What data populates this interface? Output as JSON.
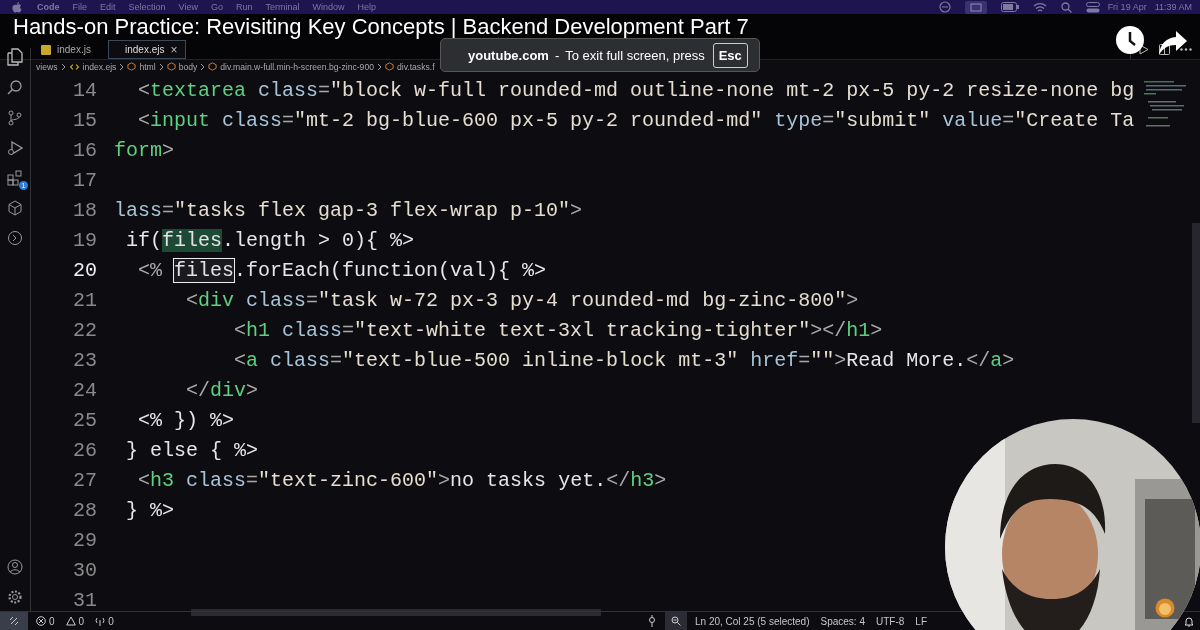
{
  "menu_bar": {
    "app": "Code",
    "items": [
      "File",
      "Edit",
      "Selection",
      "View",
      "Go",
      "Run",
      "Terminal",
      "Window",
      "Help"
    ],
    "date": "Fri 19 Apr",
    "time": "11:39 AM"
  },
  "video_title": "Hands-on Practice: Revisiting Key Concepts | Backend Development Part 7",
  "tabs": [
    {
      "label": "index.js",
      "selected": false,
      "kind": "js"
    },
    {
      "label": "index.ejs",
      "selected": true,
      "kind": "ejs",
      "close": "×"
    }
  ],
  "breadcrumb": [
    {
      "label": "views",
      "kind": "folder"
    },
    {
      "label": "index.ejs",
      "kind": "ejs"
    },
    {
      "label": "html",
      "kind": "element"
    },
    {
      "label": "body",
      "kind": "element"
    },
    {
      "label": "div.main.w-full.min-h-screen.bg-zinc-900",
      "kind": "element"
    },
    {
      "label": "div.tasks.f",
      "kind": "element"
    }
  ],
  "toast": {
    "site": "youtube.com",
    "separator": "-",
    "message": "To exit full screen, press",
    "key": "Esc"
  },
  "extensions_badge": "1",
  "lines": [
    {
      "number": "14",
      "current": false,
      "tokens": [
        {
          "kind": "punct",
          "text": "  <"
        },
        {
          "kind": "tag",
          "text": "textarea"
        },
        {
          "kind": "attr",
          "text": " class"
        },
        {
          "kind": "punct",
          "text": "="
        },
        {
          "kind": "str",
          "text": "\"block w-full rounded-md outline-none mt-2 px-5 py-2 resize-none bg"
        }
      ]
    },
    {
      "number": "15",
      "current": false,
      "tokens": [
        {
          "kind": "punct",
          "text": "  <"
        },
        {
          "kind": "tag",
          "text": "input"
        },
        {
          "kind": "attr",
          "text": " class"
        },
        {
          "kind": "punct",
          "text": "="
        },
        {
          "kind": "str",
          "text": "\"mt-2 bg-blue-600 px-5 py-2 rounded-md\""
        },
        {
          "kind": "attr",
          "text": " type"
        },
        {
          "kind": "punct",
          "text": "="
        },
        {
          "kind": "str",
          "text": "\"submit\""
        },
        {
          "kind": "attr",
          "text": " value"
        },
        {
          "kind": "punct",
          "text": "="
        },
        {
          "kind": "str",
          "text": "\"Create Ta"
        }
      ]
    },
    {
      "number": "16",
      "current": false,
      "tokens": [
        {
          "kind": "tag",
          "text": "form"
        },
        {
          "kind": "punct",
          "text": ">"
        }
      ]
    },
    {
      "number": "17",
      "current": false
    },
    {
      "number": "18",
      "current": false,
      "tokens": [
        {
          "kind": "attr",
          "text": "lass"
        },
        {
          "kind": "punct",
          "text": "="
        },
        {
          "kind": "str",
          "text": "\"tasks flex gap-3 flex-wrap p-10\""
        },
        {
          "kind": "punct",
          "text": ">"
        }
      ]
    },
    {
      "number": "19",
      "current": false,
      "tokens": [
        {
          "kind": "text",
          "text": " if("
        },
        {
          "kind": "match",
          "text": "files"
        },
        {
          "kind": "text",
          "text": ".length > 0){ %>"
        }
      ]
    },
    {
      "number": "20",
      "current": true,
      "tokens": [
        {
          "kind": "punct",
          "text": "  <% "
        },
        {
          "kind": "sel",
          "text": "files"
        },
        {
          "kind": "text",
          "text": ".forEach(function(val){ %>"
        }
      ]
    },
    {
      "number": "21",
      "current": false,
      "tokens": [
        {
          "kind": "punct",
          "text": "      <"
        },
        {
          "kind": "tag",
          "text": "div"
        },
        {
          "kind": "attr",
          "text": " class"
        },
        {
          "kind": "punct",
          "text": "="
        },
        {
          "kind": "str",
          "text": "\"task w-72 px-3 py-4 rounded-md bg-zinc-800\""
        },
        {
          "kind": "punct",
          "text": ">"
        }
      ]
    },
    {
      "number": "22",
      "current": false,
      "tokens": [
        {
          "kind": "punct",
          "text": "          <"
        },
        {
          "kind": "tag",
          "text": "h1"
        },
        {
          "kind": "attr",
          "text": " class"
        },
        {
          "kind": "punct",
          "text": "="
        },
        {
          "kind": "str",
          "text": "\"text-white text-3xl tracking-tighter\""
        },
        {
          "kind": "punct",
          "text": "></"
        },
        {
          "kind": "tag",
          "text": "h1"
        },
        {
          "kind": "punct",
          "text": ">"
        }
      ]
    },
    {
      "number": "23",
      "current": false,
      "tokens": [
        {
          "kind": "punct",
          "text": "          <"
        },
        {
          "kind": "tag",
          "text": "a"
        },
        {
          "kind": "attr",
          "text": " class"
        },
        {
          "kind": "punct",
          "text": "="
        },
        {
          "kind": "str",
          "text": "\"text-blue-500 inline-block mt-3\""
        },
        {
          "kind": "attr",
          "text": " href"
        },
        {
          "kind": "punct",
          "text": "="
        },
        {
          "kind": "str",
          "text": "\"\""
        },
        {
          "kind": "punct",
          "text": ">"
        },
        {
          "kind": "text",
          "text": "Read More."
        },
        {
          "kind": "punct",
          "text": "</"
        },
        {
          "kind": "tag",
          "text": "a"
        },
        {
          "kind": "punct",
          "text": ">"
        }
      ]
    },
    {
      "number": "24",
      "current": false,
      "tokens": [
        {
          "kind": "punct",
          "text": "      </"
        },
        {
          "kind": "tag",
          "text": "div"
        },
        {
          "kind": "punct",
          "text": ">"
        }
      ]
    },
    {
      "number": "25",
      "current": false,
      "tokens": [
        {
          "kind": "text",
          "text": "  <% }) %>"
        }
      ]
    },
    {
      "number": "26",
      "current": false,
      "tokens": [
        {
          "kind": "text",
          "text": " } else { %>"
        }
      ]
    },
    {
      "number": "27",
      "current": false,
      "tokens": [
        {
          "kind": "punct",
          "text": "  <"
        },
        {
          "kind": "tag",
          "text": "h3"
        },
        {
          "kind": "attr",
          "text": " class"
        },
        {
          "kind": "punct",
          "text": "="
        },
        {
          "kind": "str",
          "text": "\"text-zinc-600\""
        },
        {
          "kind": "punct",
          "text": ">"
        },
        {
          "kind": "text",
          "text": "no tasks yet."
        },
        {
          "kind": "punct",
          "text": "</"
        },
        {
          "kind": "tag",
          "text": "h3"
        },
        {
          "kind": "punct",
          "text": ">"
        }
      ]
    },
    {
      "number": "28",
      "current": false,
      "tokens": [
        {
          "kind": "text",
          "text": " } %>"
        }
      ]
    },
    {
      "number": "29",
      "current": false
    },
    {
      "number": "30",
      "current": false
    },
    {
      "number": "31",
      "current": false
    }
  ],
  "status_bar": {
    "errors": "0",
    "warnings": "0",
    "ports": "0",
    "position": "Ln 20, Col 25 (5 selected)",
    "spaces": "Spaces: 4",
    "encoding": "UTF-8",
    "eol": "LF"
  }
}
